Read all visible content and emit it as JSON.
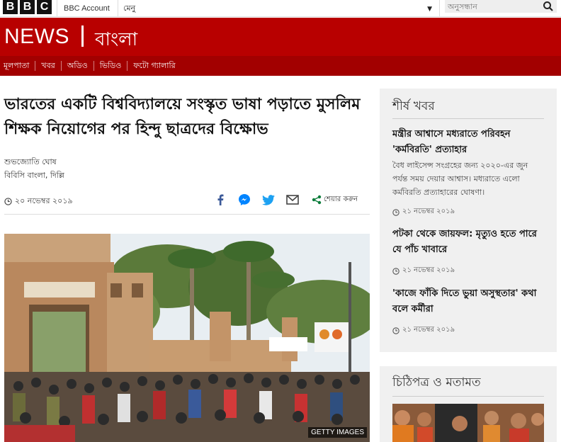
{
  "topbar": {
    "logo_letters": [
      "B",
      "B",
      "C"
    ],
    "account_label": "BBC Account",
    "menu_label": "মেনু",
    "search_placeholder": "অনুসন্ধান"
  },
  "header": {
    "news_logo": "NEWS",
    "service_logo": "বাংলা",
    "nav": [
      "মূলপাতা",
      "খবর",
      "অডিও",
      "ভিডিও",
      "ফটো গ্যালারি"
    ],
    "brand_color": "#b80000"
  },
  "article": {
    "headline": "ভারতের একটি বিশ্ববিদ্যালয়ে সংস্কৃত ভাষা পড়াতে মুসলিম শিক্ষক নিয়োগের পর হিন্দু ছাত্রদের বিক্ষোভ",
    "author": "শুভজ্যোতি ঘোষ",
    "organization": "বিবিসি বাংলা, দিল্লি",
    "date": "২০ নভেম্বর ২০১৯",
    "share_label": "শেয়ার করুন",
    "photo_credit": "GETTY IMAGES"
  },
  "sidebar": {
    "top_title": "শীর্ষ খবর",
    "stories": [
      {
        "headline": "মন্ত্রীর আশ্বাসে মধ্যরাতে পরিবহন 'কর্মবিরতি' প্রত্যাহার",
        "summary": "বৈধ লাইসেন্স সংগ্রহের জন্য ২০২০-এর জুন পর্যন্ত সময় দেয়ার আশ্বাস। মধ্যরাতে এলো কর্মবিরতি প্রত্যাহারের ঘোষণা।",
        "date": "২১ নভেম্বর ২০১৯"
      },
      {
        "headline": "পটকা থেকে জায়ফল: মৃত্যুও হতে পারে যে পাঁচ খাবারে",
        "summary": "",
        "date": "২১ নভেম্বর ২০১৯"
      },
      {
        "headline": "'কাজে ফাঁকি দিতে ভুয়া অসুস্থতার' কথা বলে কর্মীরা",
        "summary": "",
        "date": "২১ নভেম্বর ২০১৯"
      }
    ],
    "letters_title": "চিঠিপত্র ও মতামত"
  }
}
